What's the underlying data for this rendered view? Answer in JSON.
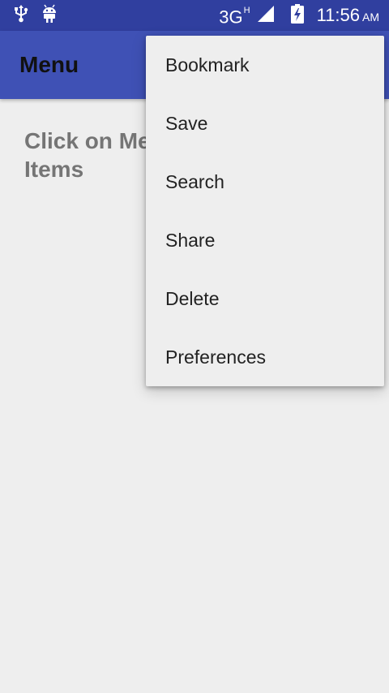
{
  "status_bar": {
    "left_icons": [
      "usb-icon",
      "android-debug-icon"
    ],
    "network_type": "3G",
    "network_sup": "H",
    "time": "11:56",
    "ampm": "AM"
  },
  "app_bar": {
    "title": "Menu"
  },
  "main": {
    "text": "Click on Menu Items"
  },
  "popup_menu": {
    "items": [
      {
        "label": "Bookmark"
      },
      {
        "label": "Save"
      },
      {
        "label": "Search"
      },
      {
        "label": "Share"
      },
      {
        "label": "Delete"
      },
      {
        "label": "Preferences"
      }
    ]
  },
  "colors": {
    "status_bar": "#303f9f",
    "app_bar": "#3f51b5",
    "background": "#eeeeee"
  }
}
